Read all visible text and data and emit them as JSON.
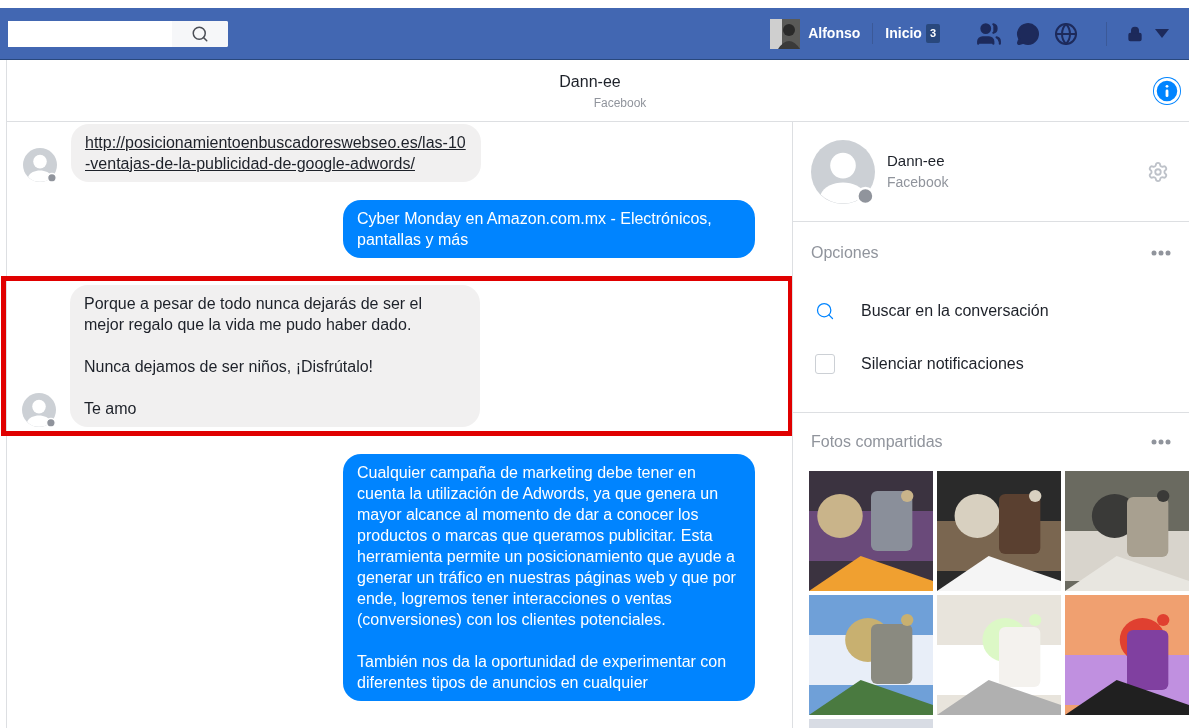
{
  "top_bar": {
    "user_name": "Alfonso",
    "home_label": "Inicio",
    "home_badge": "3"
  },
  "conversation_header": {
    "title": "Dann-ee",
    "subtitle": "Facebook"
  },
  "messages": [
    {
      "kind": "incoming",
      "highlighted": false,
      "paragraphs": [
        "http://posicionamientoenbuscadoreswebseo.es/las-10-ventajas-de-la-publicidad-de-google-adwords/"
      ],
      "link": true
    },
    {
      "kind": "outgoing",
      "highlighted": false,
      "paragraphs": [
        "Cyber Monday en Amazon.com.mx - Electrónicos, pantallas y más"
      ],
      "link": false
    },
    {
      "kind": "incoming",
      "highlighted": true,
      "paragraphs": [
        "Porque a pesar de todo nunca dejarás de ser el mejor regalo que la vida me pudo haber dado.",
        "Nunca dejamos de ser niños, ¡Disfrútalo!",
        "Te amo"
      ],
      "link": false
    },
    {
      "kind": "outgoing",
      "highlighted": false,
      "paragraphs": [
        "Cualquier campaña de marketing debe tener en cuenta la utilización de Adwords, ya que genera un mayor alcance al momento de dar a conocer los productos o marcas que queramos publicitar. Esta herramienta permite un posicionamiento que ayude a generar un tráfico en nuestras páginas web y que por ende, logremos tener interacciones o ventas (conversiones) con los clientes potenciales.",
        "También nos da la oportunidad de experimentar con diferentes tipos de anuncios en cualquier"
      ],
      "link": false
    }
  ],
  "contact": {
    "name": "Dann-ee",
    "source": "Facebook"
  },
  "options": {
    "title": "Opciones",
    "items": [
      {
        "kind": "search",
        "label": "Buscar en la conversación"
      },
      {
        "kind": "checkbox",
        "label": "Silenciar notificaciones",
        "checked": false
      }
    ]
  },
  "shared_photos": {
    "title": "Fotos compartidas"
  }
}
